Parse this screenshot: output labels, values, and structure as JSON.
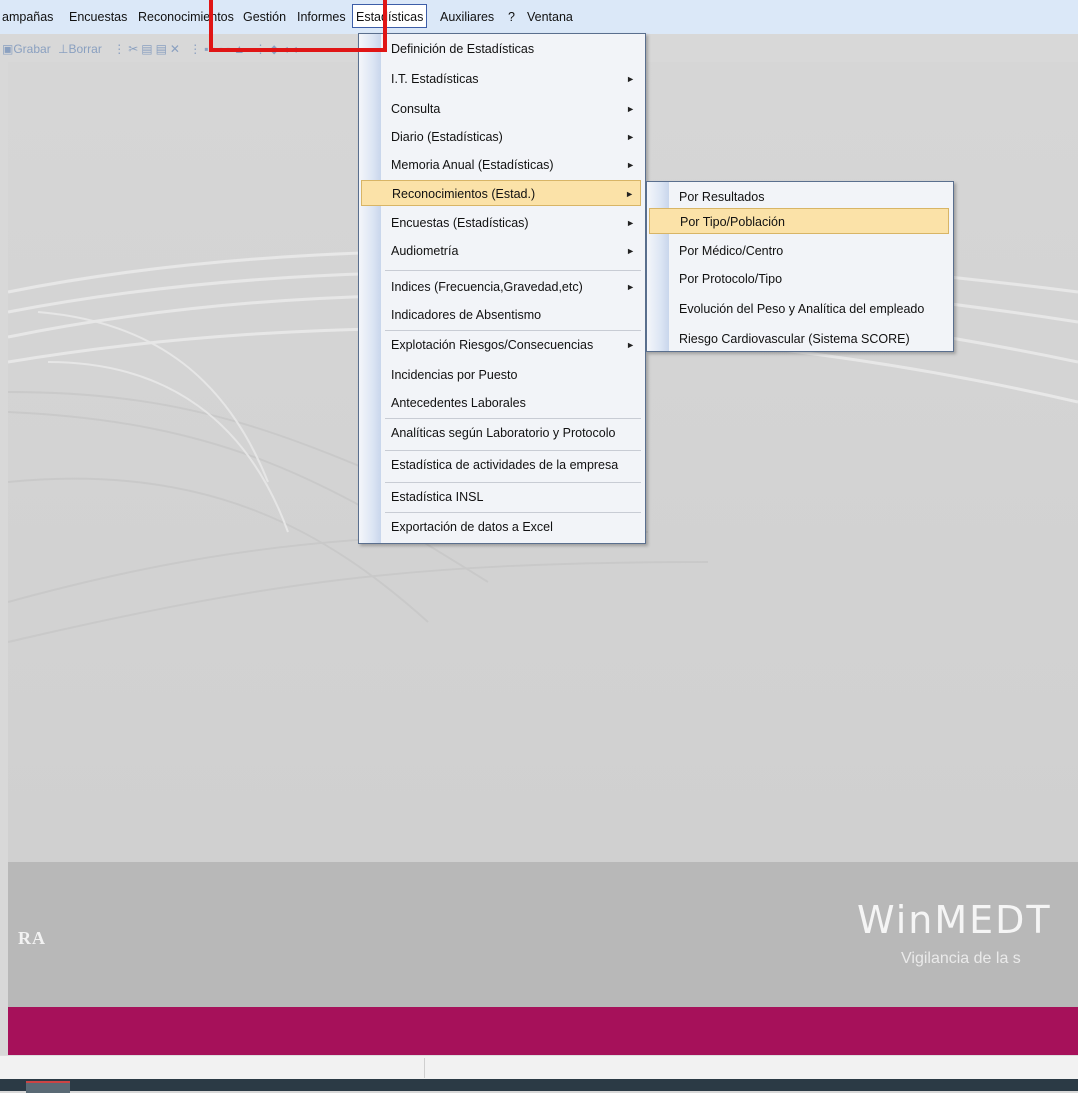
{
  "menubar": {
    "items": [
      "ampañas",
      "Encuestas",
      "Reconocimientos",
      "Gestión",
      "Informes",
      "Estadísticas",
      "Auxiliares",
      "?",
      "Ventana"
    ]
  },
  "toolbar": {
    "grabar": "Grabar",
    "borrar": "Borrar"
  },
  "estadisticas_menu": {
    "items": [
      {
        "label": "Definición de Estadísticas",
        "submenu": false
      },
      {
        "label": "I.T. Estadísticas",
        "submenu": true
      },
      {
        "label": "Consulta",
        "submenu": true
      },
      {
        "label": "Diario (Estadísticas)",
        "submenu": true
      },
      {
        "label": "Memoria Anual (Estadísticas)",
        "submenu": true
      },
      {
        "label": "Reconocimientos (Estad.)",
        "submenu": true
      },
      {
        "label": "Encuestas (Estadísticas)",
        "submenu": true
      },
      {
        "label": "Audiometría",
        "submenu": true
      },
      {
        "label": "Indices (Frecuencia,Gravedad,etc)",
        "submenu": true
      },
      {
        "label": "Indicadores de Absentismo",
        "submenu": false
      },
      {
        "label": "Explotación Riesgos/Consecuencias",
        "submenu": true
      },
      {
        "label": "Incidencias por Puesto",
        "submenu": false
      },
      {
        "label": "Antecedentes Laborales",
        "submenu": false
      },
      {
        "label": "Analíticas según Laboratorio y Protocolo",
        "submenu": false
      },
      {
        "label": "Estadística de actividades de la empresa",
        "submenu": false
      },
      {
        "label": "Estadística INSL",
        "submenu": false
      },
      {
        "label": "Exportación de datos a Excel",
        "submenu": false
      }
    ],
    "highlighted": "Reconocimientos (Estad.)"
  },
  "reconocimientos_submenu": {
    "items": [
      "Por Resultados",
      "Por Tipo/Población",
      "Por Médico/Centro",
      "Por Protocolo/Tipo",
      "Evolución del Peso y Analítica del empleado",
      "Riesgo Cardiovascular (Sistema SCORE)"
    ],
    "highlighted": "Por Tipo/Población"
  },
  "footer": {
    "left_text": "RA",
    "brand": "WinMEDT",
    "brand_sub": "Vigilancia de la s"
  },
  "colors": {
    "menubar": "#dbe8f8",
    "highlight_item": "#fbe2a8",
    "footer_bar": "#a6115a",
    "red_box": "#e01515"
  },
  "icons": {
    "submenu_arrow": "►"
  }
}
